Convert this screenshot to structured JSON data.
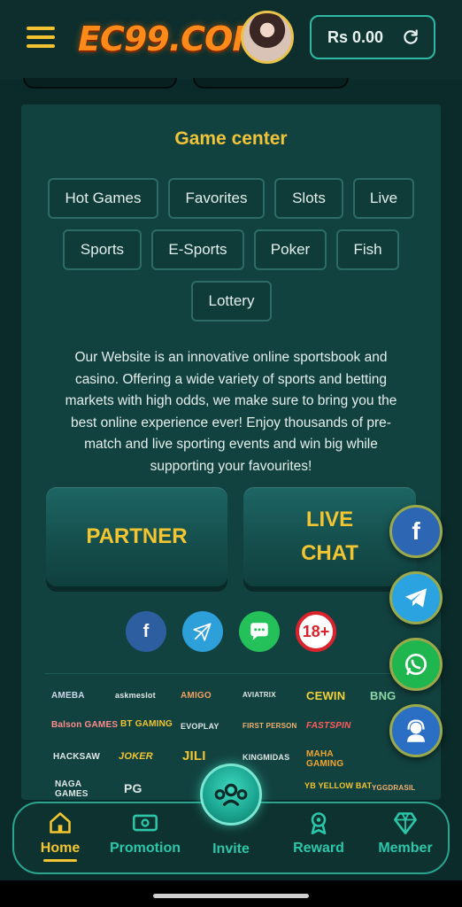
{
  "header": {
    "logo_text": "EC99.COM",
    "balance": "Rs 0.00"
  },
  "game_center": {
    "title": "Game center",
    "categories": [
      "Hot Games",
      "Favorites",
      "Slots",
      "Live",
      "Sports",
      "E-Sports",
      "Poker",
      "Fish",
      "Lottery"
    ]
  },
  "description": "Our Website is an innovative online sportsbook and casino. Offering a wide variety of sports and betting markets with high odds, we make sure to bring you the best online experience ever! Enjoy thousands of pre-match and live sporting events and win big while supporting your favourites!",
  "actions": {
    "partner_label": "PARTNER",
    "live_chat_label_1": "LIVE",
    "live_chat_label_2": "CHAT"
  },
  "social": {
    "facebook_glyph": "f",
    "age_badge": "18+"
  },
  "providers": [
    "AMEBA",
    "askmeslot",
    "AMIGO",
    "AVIATRIX",
    "CEWIN",
    "BNG",
    "Balson GAMES",
    "BT GAMING",
    "EVOPLAY",
    "FIRST PERSON",
    "FASTSPIN",
    "HACKSAW",
    "JOKER",
    "JILI",
    "KINGMIDAS",
    "MAHA GAMING",
    "NAGA GAMES",
    "PG",
    "YB YELLOW BAT",
    "YGGDRASIL"
  ],
  "nav": {
    "home": "Home",
    "promotion": "Promotion",
    "invite": "Invite",
    "reward": "Reward",
    "member": "Member"
  },
  "colors": {
    "accent": "#f2c531",
    "teal": "#2cc6a8",
    "background": "#0b2a2a"
  }
}
